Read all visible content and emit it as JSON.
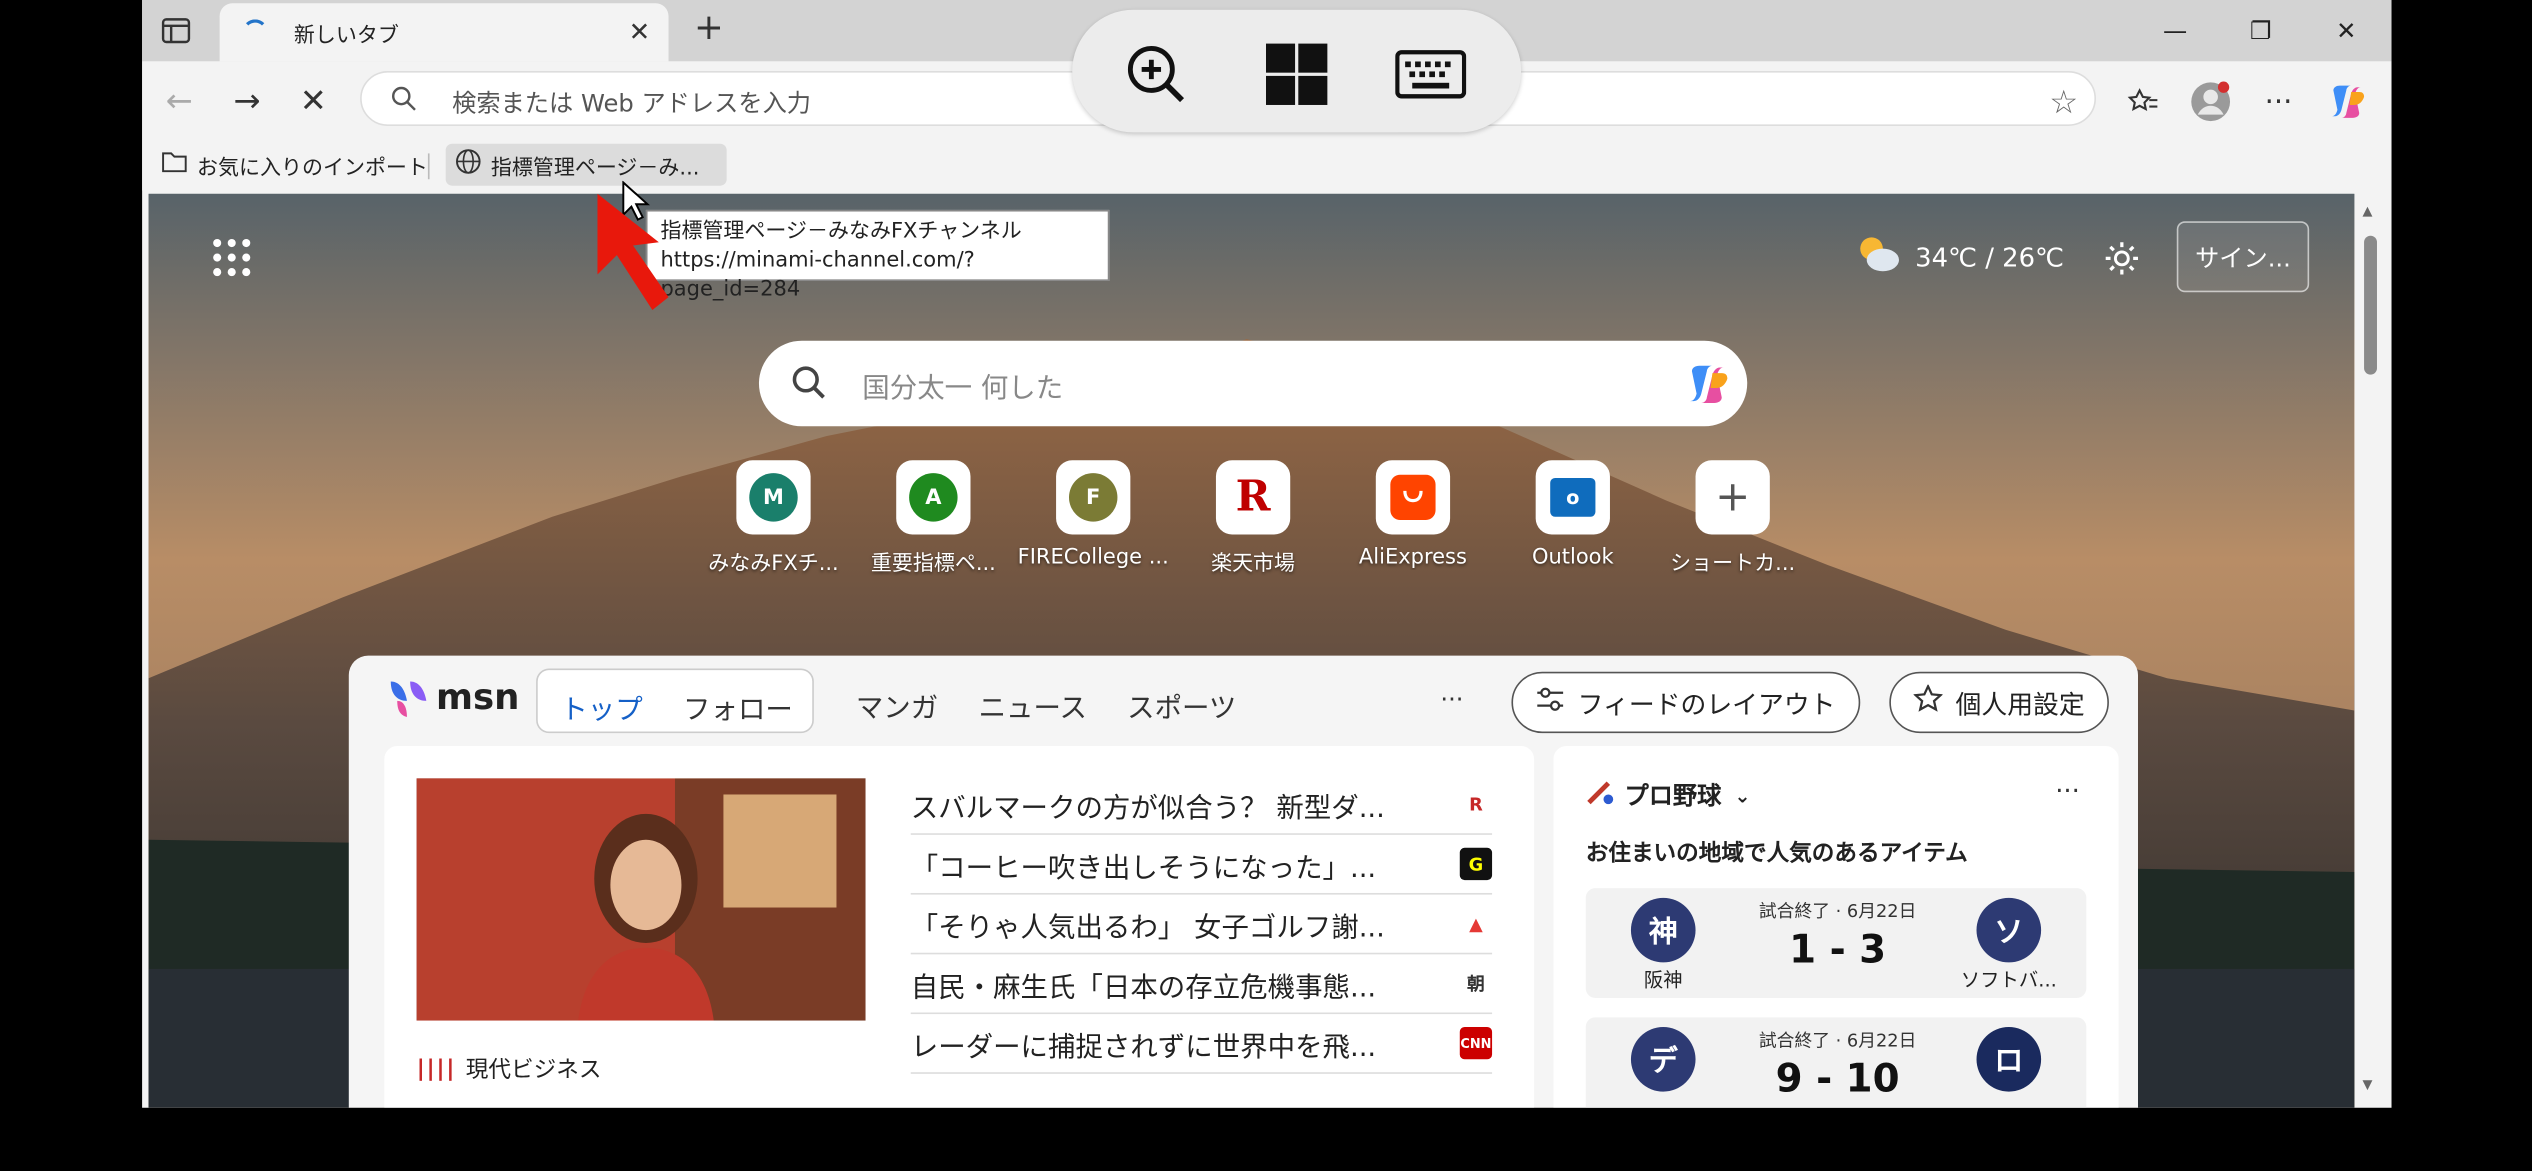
{
  "tab": {
    "title": "新しいタブ",
    "close": "✕",
    "new": "+"
  },
  "window": {
    "minimize": "—",
    "restore": "❐",
    "close": "✕"
  },
  "address": {
    "placeholder": "検索または Web アドレスを入力",
    "back": "←",
    "forward": "→",
    "stop": "✕"
  },
  "favorites": [
    {
      "label": "お気に入りのインポート"
    },
    {
      "label": "指標管理ページ－み..."
    }
  ],
  "tooltip": {
    "title": "指標管理ページ－みなみFXチャンネル",
    "url": "https://minami-channel.com/?page_id=284"
  },
  "weather": {
    "temps": "34℃ / 26℃"
  },
  "signin": "サイン...",
  "search": {
    "query": "国分太一 何した"
  },
  "quicklinks": [
    {
      "letter": "M",
      "label": "みなみFXチ...",
      "color": "#1a7f6b"
    },
    {
      "letter": "A",
      "label": "重要指標ペ...",
      "color": "#1f8a1f"
    },
    {
      "letter": "F",
      "label": "FIRECollege ...",
      "color": "#7b7b35"
    },
    {
      "letter": "R",
      "label": "楽天市場",
      "color": "#bf0000"
    },
    {
      "letter": "",
      "label": "AliExpress",
      "color": "#ff4400"
    },
    {
      "letter": "",
      "label": "Outlook",
      "color": "#0f6cbd"
    },
    {
      "letter": "+",
      "label": "ショートカ...",
      "color": "#555555"
    }
  ],
  "feed": {
    "brand": "msn",
    "tabs": [
      "トップ",
      "フォロー"
    ],
    "categories": [
      "マンガ",
      "ニュース",
      "スポーツ"
    ],
    "more": "···",
    "layout_btn": "フィードのレイアウト",
    "personal_btn": "個人用設定",
    "source": "現代ビジネス",
    "headlines": [
      {
        "text": "スバルマークの方が似合う？ 新型ダ...",
        "logo": "R",
        "logo_color": "#c62828"
      },
      {
        "text": "「コーヒー吹き出しそうになった」...",
        "logo": "G",
        "logo_color": "#111111"
      },
      {
        "text": "「そりゃ人気出るわ」 女子ゴルフ謝...",
        "logo": "▲",
        "logo_color": "#e53935"
      },
      {
        "text": "自民・麻生氏「日本の存立危機事態...",
        "logo": "朝",
        "logo_color": "#333333"
      },
      {
        "text": "レーダーに捕捉されずに世界中を飛...",
        "logo": "CNN",
        "logo_color": "#cc0000"
      }
    ],
    "sports": {
      "title": "プロ野球",
      "subtitle": "お住まいの地域で人気のあるアイテム",
      "more": "···",
      "games": [
        {
          "status": "試合終了 · 6月22日",
          "score": "1 - 3",
          "home": "神",
          "home_name": "阪神",
          "away": "ソ",
          "away_name": "ソフトバ..."
        },
        {
          "status": "試合終了 · 6月22日",
          "score": "9 - 10",
          "home": "デ",
          "home_name": "",
          "away": "ロ",
          "away_name": ""
        }
      ]
    }
  }
}
